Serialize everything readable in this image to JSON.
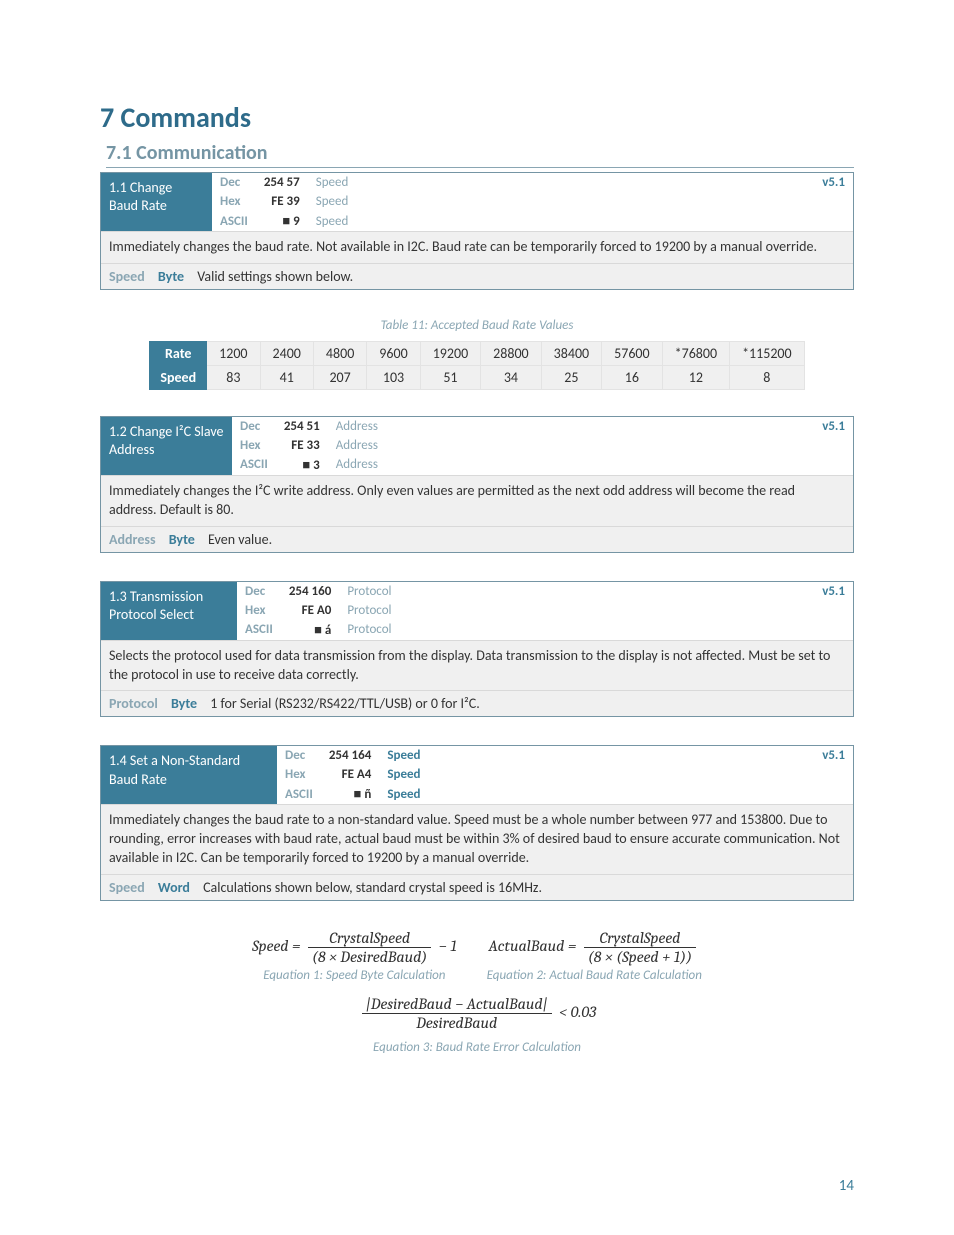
{
  "title_section": "7 Commands",
  "title_sub": "7.1 Communication",
  "version": "v5.1",
  "fmt": {
    "dec": "Dec",
    "hex": "Hex",
    "ascii": "ASCII",
    "byte": "Byte",
    "word": "Word"
  },
  "cmd11": {
    "name": "1.1 Change Baud Rate",
    "dec": "254 57",
    "hex": "FE 39",
    "ascii": "■ 9",
    "param": "Speed",
    "desc": "Immediately changes the baud rate.  Not available in I2C.  Baud rate can be temporarily forced to 19200 by a manual override.",
    "p_name": "Speed",
    "p_desc": "Valid settings shown below."
  },
  "table11_caption": "Table 11: Accepted Baud Rate Values",
  "table11": {
    "h1": "Rate",
    "h2": "Speed",
    "rates": [
      "1200",
      "2400",
      "4800",
      "9600",
      "19200",
      "28800",
      "38400",
      "57600",
      "*76800",
      "*115200"
    ],
    "speeds": [
      "83",
      "41",
      "207",
      "103",
      "51",
      "34",
      "25",
      "16",
      "12",
      "8"
    ]
  },
  "cmd12": {
    "name": "1.2 Change I²C Slave Address",
    "dec": "254 51",
    "hex": "FE 33",
    "ascii": "■ 3",
    "param": "Address",
    "desc": "Immediately changes the I²C write address.  Only even values are permitted as the next odd address will become the read address.  Default is 80.",
    "p_name": "Address",
    "p_desc": "Even value."
  },
  "cmd13": {
    "name": "1.3 Transmission Protocol Select",
    "dec": "254 160",
    "hex": "FE A0",
    "ascii": "■ á",
    "param": "Protocol",
    "desc": "Selects the protocol used for data transmission from the display.  Data transmission to the display is not affected.  Must be set to the protocol in use to receive data correctly.",
    "p_name": "Protocol",
    "p_desc": "1 for Serial (RS232/RS422/TTL/USB) or 0 for I²C."
  },
  "cmd14": {
    "name": "1.4 Set a Non-Standard Baud Rate",
    "dec": "254 164",
    "hex": "FE A4",
    "ascii": "■ ñ",
    "param": "Speed",
    "desc": "Immediately changes the baud rate to a non-standard value.  Speed must be a whole number between 977 and 153800.  Due to rounding, error increases with baud rate, actual baud must be within 3% of desired baud to ensure accurate communication.  Not available in I2C.  Can be temporarily forced to 19200 by a manual override.",
    "p_name": "Speed",
    "p_desc": "Calculations shown below, standard crystal speed is 16MHz."
  },
  "eq1_cap": "Equation 1: Speed Byte Calculation",
  "eq2_cap": "Equation 2: Actual Baud Rate Calculation",
  "eq3_cap": "Equation 3: Baud Rate Error Calculation",
  "eq": {
    "speed_lhs": "Speed = ",
    "speed_num": "CrystalSpeed",
    "speed_den": "(8 × DesiredBaud)",
    "speed_rhs": " − 1",
    "actual_lhs": "ActualBaud = ",
    "actual_num": "CrystalSpeed",
    "actual_den": "(8 × (Speed + 1))",
    "err_num": "|DesiredBaud − ActualBaud|",
    "err_den": "DesiredBaud",
    "err_rhs": " < 0.03"
  },
  "page_number": "14"
}
